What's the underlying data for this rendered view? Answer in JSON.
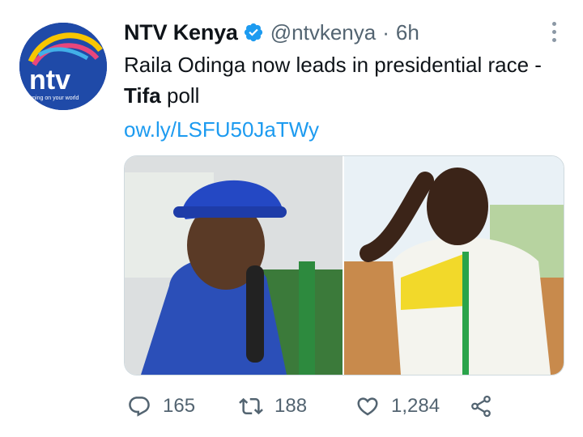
{
  "author": {
    "display_name": "NTV Kenya",
    "handle": "@ntvkenya",
    "separator": "·",
    "time": "6h",
    "verified": true,
    "avatar": {
      "logo_text": "ntv",
      "tagline": "turning on your world",
      "brand_color": "#1d3f9b"
    }
  },
  "tweet": {
    "text_plain_1": "Raila Odinga now leads in presidential race - ",
    "text_bold": "Tifa",
    "text_plain_2": " poll",
    "link": "ow.ly/LSFU50JaTWy"
  },
  "media": {
    "photos": [
      {
        "description_icon": "photo-icon"
      },
      {
        "description_icon": "photo-icon"
      }
    ]
  },
  "actions": {
    "reply_count": "165",
    "retweet_count": "188",
    "like_count": "1,284"
  },
  "colors": {
    "link": "#1d9bf0",
    "secondary_text": "#536471",
    "verified_badge": "#1d9bf0"
  }
}
